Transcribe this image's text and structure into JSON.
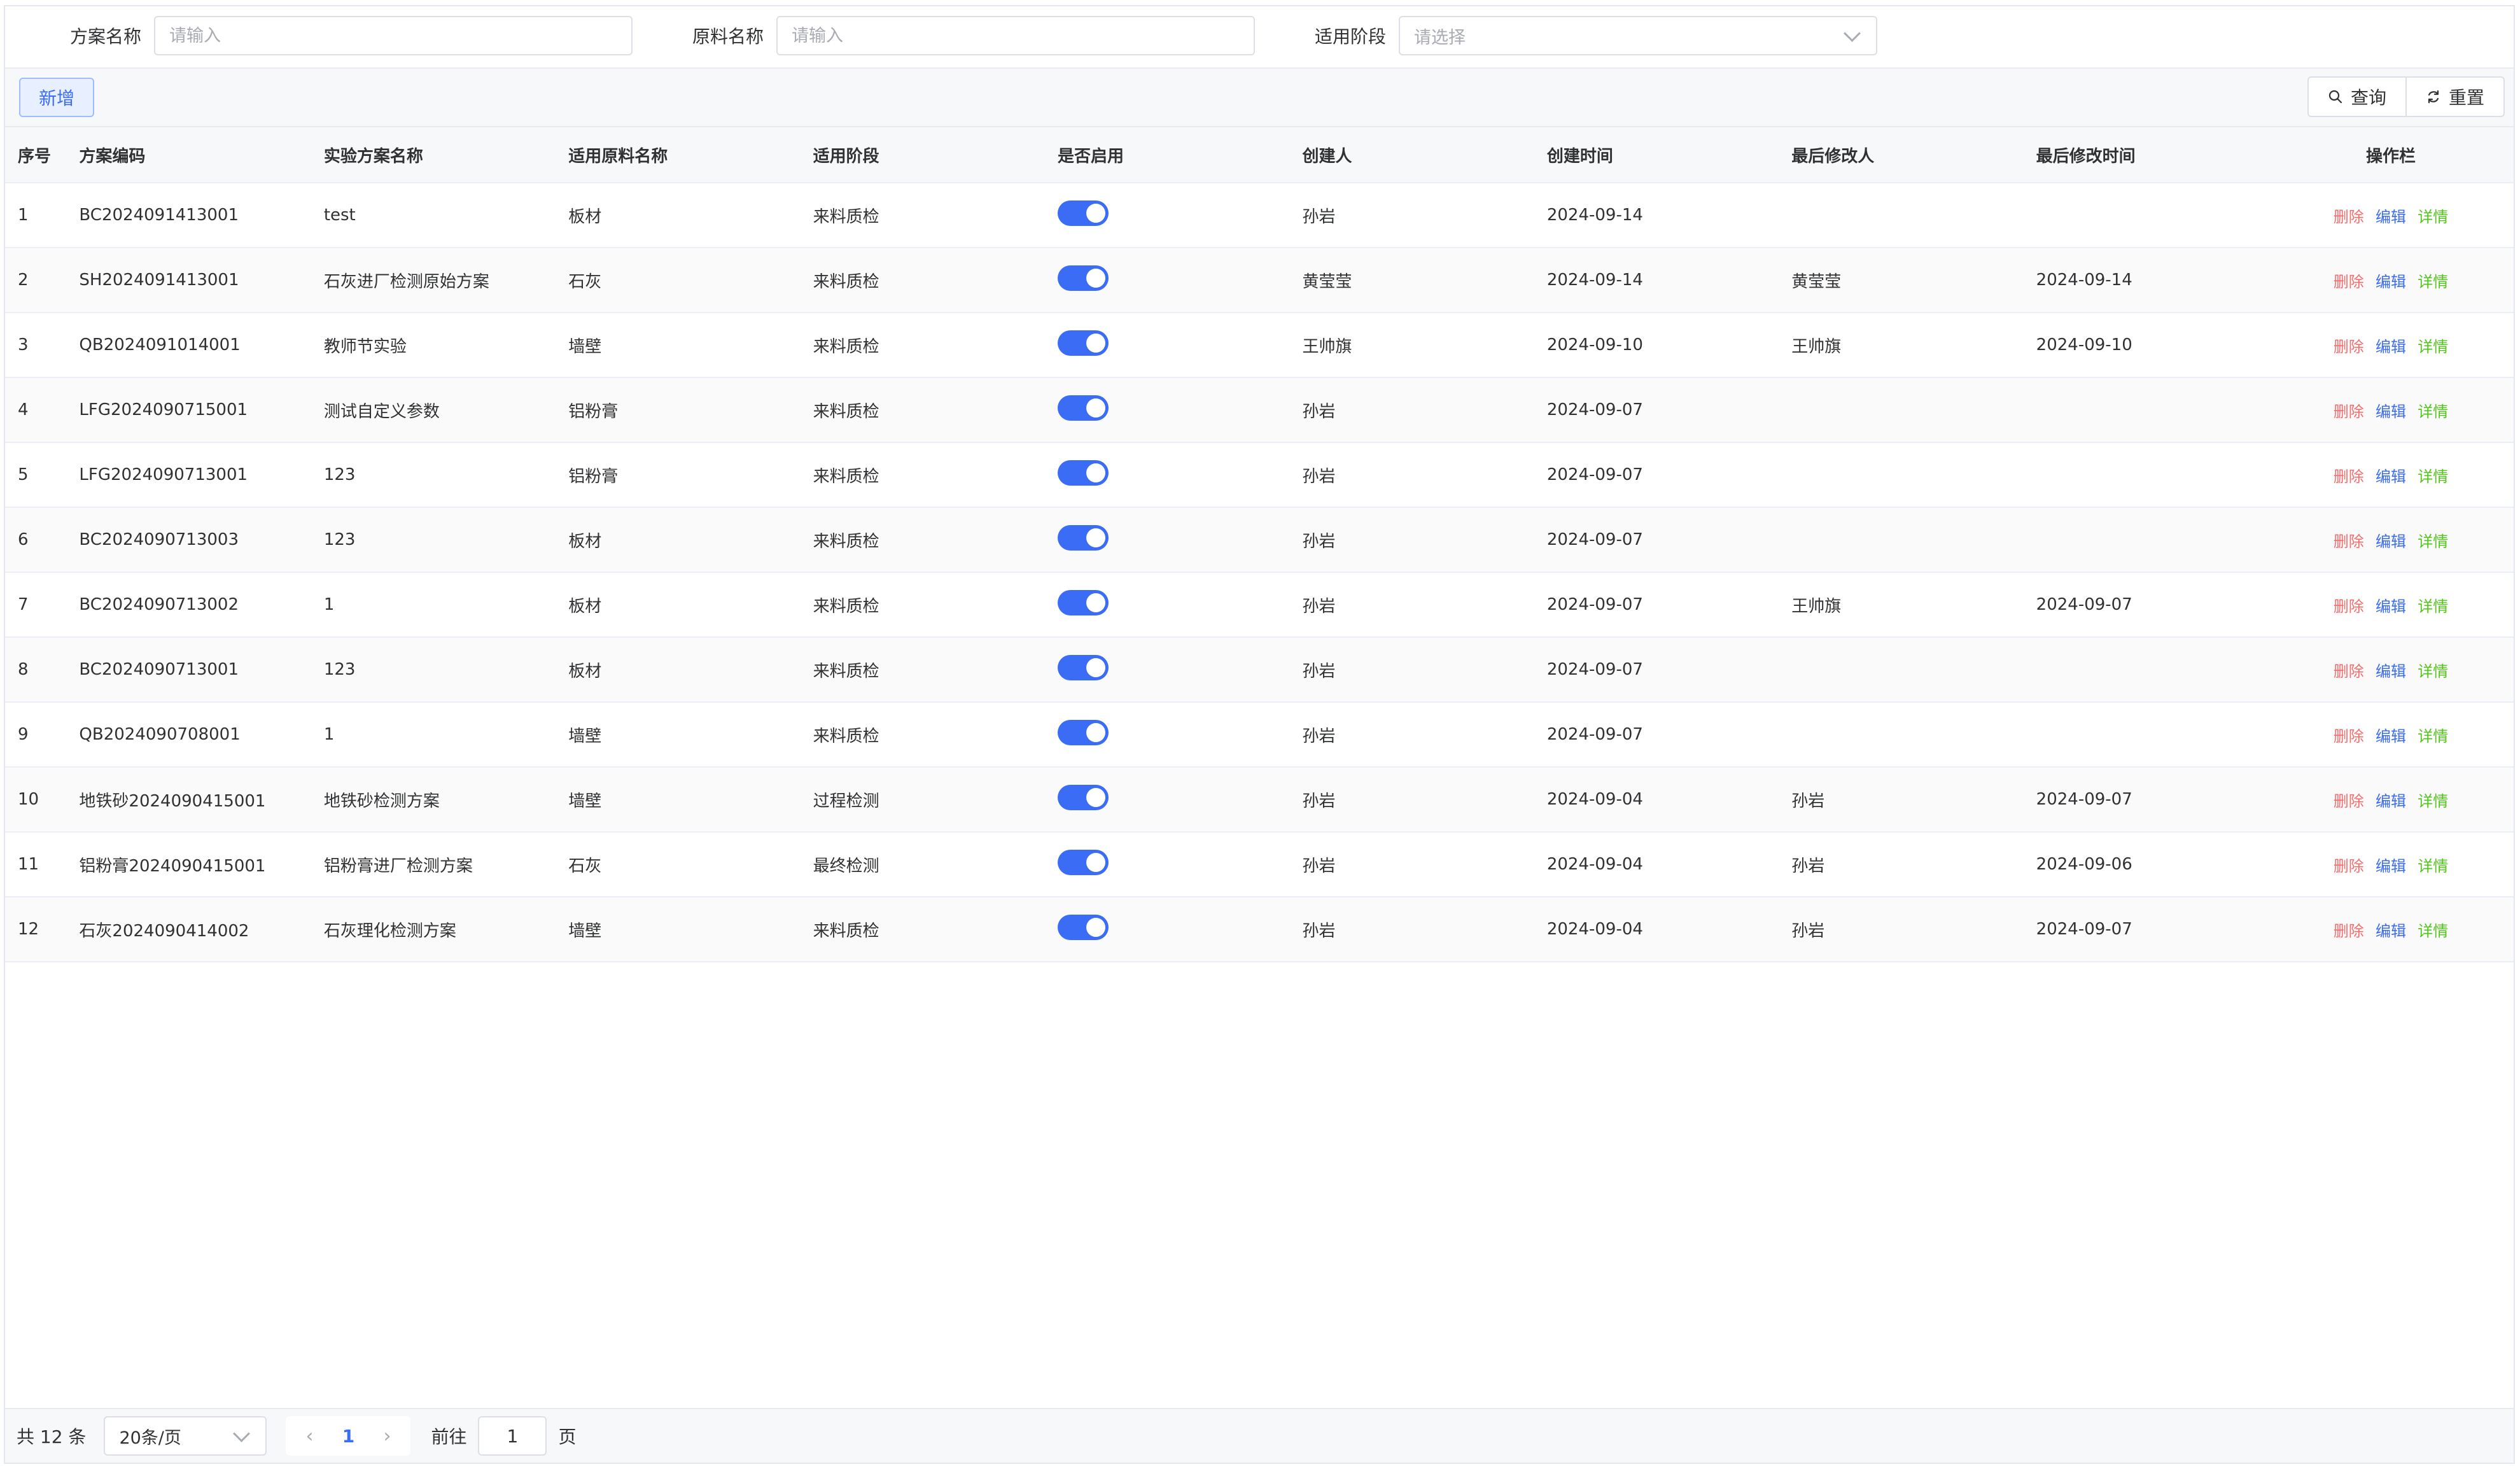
{
  "search": {
    "plan_name_label": "方案名称",
    "plan_name_placeholder": "请输入",
    "material_name_label": "原料名称",
    "material_name_placeholder": "请输入",
    "stage_label": "适用阶段",
    "stage_placeholder": "请选择"
  },
  "toolbar": {
    "add_label": "新增",
    "query_label": "查询",
    "reset_label": "重置"
  },
  "table": {
    "headers": [
      "序号",
      "方案编码",
      "实验方案名称",
      "适用原料名称",
      "适用阶段",
      "是否启用",
      "创建人",
      "创建时间",
      "最后修改人",
      "最后修改时间",
      "操作栏"
    ],
    "actions": {
      "delete": "删除",
      "edit": "编辑",
      "detail": "详情"
    },
    "rows": [
      {
        "index": "1",
        "code": "BC2024091413001",
        "name": "test",
        "material": "板材",
        "stage": "来料质检",
        "enabled": true,
        "creator": "孙岩",
        "created": "2024-09-14",
        "modifier": "",
        "modified": ""
      },
      {
        "index": "2",
        "code": "SH2024091413001",
        "name": "石灰进厂检测原始方案",
        "material": "石灰",
        "stage": "来料质检",
        "enabled": true,
        "creator": "黄莹莹",
        "created": "2024-09-14",
        "modifier": "黄莹莹",
        "modified": "2024-09-14"
      },
      {
        "index": "3",
        "code": "QB2024091014001",
        "name": "教师节实验",
        "material": "墙壁",
        "stage": "来料质检",
        "enabled": true,
        "creator": "王帅旗",
        "created": "2024-09-10",
        "modifier": "王帅旗",
        "modified": "2024-09-10"
      },
      {
        "index": "4",
        "code": "LFG2024090715001",
        "name": "测试自定义参数",
        "material": "铝粉膏",
        "stage": "来料质检",
        "enabled": true,
        "creator": "孙岩",
        "created": "2024-09-07",
        "modifier": "",
        "modified": ""
      },
      {
        "index": "5",
        "code": "LFG2024090713001",
        "name": "123",
        "material": "铝粉膏",
        "stage": "来料质检",
        "enabled": true,
        "creator": "孙岩",
        "created": "2024-09-07",
        "modifier": "",
        "modified": ""
      },
      {
        "index": "6",
        "code": "BC2024090713003",
        "name": "123",
        "material": "板材",
        "stage": "来料质检",
        "enabled": true,
        "creator": "孙岩",
        "created": "2024-09-07",
        "modifier": "",
        "modified": ""
      },
      {
        "index": "7",
        "code": "BC2024090713002",
        "name": "1",
        "material": "板材",
        "stage": "来料质检",
        "enabled": true,
        "creator": "孙岩",
        "created": "2024-09-07",
        "modifier": "王帅旗",
        "modified": "2024-09-07"
      },
      {
        "index": "8",
        "code": "BC2024090713001",
        "name": "123",
        "material": "板材",
        "stage": "来料质检",
        "enabled": true,
        "creator": "孙岩",
        "created": "2024-09-07",
        "modifier": "",
        "modified": ""
      },
      {
        "index": "9",
        "code": "QB2024090708001",
        "name": "1",
        "material": "墙壁",
        "stage": "来料质检",
        "enabled": true,
        "creator": "孙岩",
        "created": "2024-09-07",
        "modifier": "",
        "modified": ""
      },
      {
        "index": "10",
        "code": "地铁砂2024090415001",
        "name": "地铁砂检测方案",
        "material": "墙壁",
        "stage": "过程检测",
        "enabled": true,
        "creator": "孙岩",
        "created": "2024-09-04",
        "modifier": "孙岩",
        "modified": "2024-09-07"
      },
      {
        "index": "11",
        "code": "铝粉膏2024090415001",
        "name": "铝粉膏进厂检测方案",
        "material": "石灰",
        "stage": "最终检测",
        "enabled": true,
        "creator": "孙岩",
        "created": "2024-09-04",
        "modifier": "孙岩",
        "modified": "2024-09-06"
      },
      {
        "index": "12",
        "code": "石灰2024090414002",
        "name": "石灰理化检测方案",
        "material": "墙壁",
        "stage": "来料质检",
        "enabled": true,
        "creator": "孙岩",
        "created": "2024-09-04",
        "modifier": "孙岩",
        "modified": "2024-09-07"
      }
    ]
  },
  "pagination": {
    "total_text": "共 12 条",
    "page_size": "20条/页",
    "current_page": "1",
    "goto_label": "前往",
    "goto_value": "1",
    "page_unit": "页"
  },
  "colors": {
    "accent": "#3b6cf6",
    "delete": "#f56c6c",
    "detail": "#52c41a"
  },
  "icons": {
    "query": "search-icon",
    "reset": "refresh-icon",
    "select": "chevron-down-icon"
  }
}
